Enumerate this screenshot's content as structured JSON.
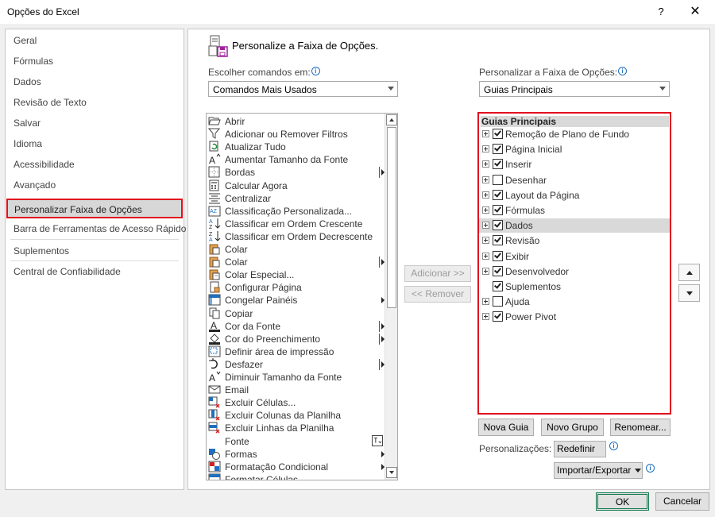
{
  "window": {
    "title": "Opções do Excel",
    "help": "?",
    "close": "✕"
  },
  "nav": {
    "items": [
      "Geral",
      "Fórmulas",
      "Dados",
      "Revisão de Texto",
      "Salvar",
      "Idioma",
      "Acessibilidade",
      "Avançado",
      "Personalizar Faixa de Opções",
      "Barra de Ferramentas de Acesso Rápido",
      "Suplementos",
      "Central de Confiabilidade"
    ],
    "selected": "Personalizar Faixa de Opções"
  },
  "main": {
    "heading": "Personalize a Faixa de Opções.",
    "choose_label": "Escolher comandos em:",
    "choose_value": "Comandos Mais Usados",
    "customize_label": "Personalizar a Faixa de Opções:",
    "customize_value": "Guias Principais"
  },
  "commands": [
    {
      "label": "Abrir",
      "icon": "folder-open-icon",
      "sub": false
    },
    {
      "label": "Adicionar ou Remover Filtros",
      "icon": "filter-icon",
      "sub": false
    },
    {
      "label": "Atualizar Tudo",
      "icon": "refresh-icon",
      "sub": false
    },
    {
      "label": "Aumentar Tamanho da Fonte",
      "icon": "font-grow-icon",
      "sub": false
    },
    {
      "label": "Bordas",
      "icon": "borders-icon",
      "sub": "bar"
    },
    {
      "label": "Calcular Agora",
      "icon": "calculator-icon",
      "sub": false
    },
    {
      "label": "Centralizar",
      "icon": "align-center-icon",
      "sub": false
    },
    {
      "label": "Classificação Personalizada...",
      "icon": "custom-sort-icon",
      "sub": false
    },
    {
      "label": "Classificar em Ordem Crescente",
      "icon": "sort-asc-icon",
      "sub": false
    },
    {
      "label": "Classificar em Ordem Decrescente",
      "icon": "sort-desc-icon",
      "sub": false
    },
    {
      "label": "Colar",
      "icon": "paste-icon",
      "sub": false
    },
    {
      "label": "Colar",
      "icon": "paste-icon",
      "sub": "bar"
    },
    {
      "label": "Colar Especial...",
      "icon": "paste-special-icon",
      "sub": false
    },
    {
      "label": "Configurar Página",
      "icon": "page-setup-icon",
      "sub": false
    },
    {
      "label": "Congelar Painéis",
      "icon": "freeze-panes-icon",
      "sub": "arrow"
    },
    {
      "label": "Copiar",
      "icon": "copy-icon",
      "sub": false
    },
    {
      "label": "Cor da Fonte",
      "icon": "font-color-icon",
      "sub": "bar"
    },
    {
      "label": "Cor do Preenchimento",
      "icon": "fill-color-icon",
      "sub": "bar"
    },
    {
      "label": "Definir área de impressão",
      "icon": "print-area-icon",
      "sub": false
    },
    {
      "label": "Desfazer",
      "icon": "undo-icon",
      "sub": "bar"
    },
    {
      "label": "Diminuir Tamanho da Fonte",
      "icon": "font-shrink-icon",
      "sub": false
    },
    {
      "label": "Email",
      "icon": "email-icon",
      "sub": false
    },
    {
      "label": "Excluir Células...",
      "icon": "delete-cells-icon",
      "sub": false
    },
    {
      "label": "Excluir Colunas da Planilha",
      "icon": "delete-columns-icon",
      "sub": false
    },
    {
      "label": "Excluir Linhas da Planilha",
      "icon": "delete-rows-icon",
      "sub": false
    },
    {
      "label": "Fonte",
      "icon": "",
      "sub": "fontbox"
    },
    {
      "label": "Formas",
      "icon": "shapes-icon",
      "sub": "arrow"
    },
    {
      "label": "Formatação Condicional",
      "icon": "conditional-format-icon",
      "sub": "arrow"
    },
    {
      "label": "Formatar Células",
      "icon": "format-cells-icon",
      "sub": false
    }
  ],
  "buttons": {
    "add": "Adicionar >>",
    "remove": "<< Remover",
    "new_tab": "Nova Guia",
    "new_group": "Novo Grupo",
    "rename": "Renomear...",
    "customizations_label": "Personalizações:",
    "reset": "Redefinir",
    "import_export": "Importar/Exportar",
    "ok": "OK",
    "cancel": "Cancelar"
  },
  "tree": {
    "header": "Guias Principais",
    "items": [
      {
        "label": "Remoção de Plano de Fundo",
        "checked": true,
        "expandable": true
      },
      {
        "label": "Página Inicial",
        "checked": true,
        "expandable": true
      },
      {
        "label": "Inserir",
        "checked": true,
        "expandable": true
      },
      {
        "label": "Desenhar",
        "checked": false,
        "expandable": true
      },
      {
        "label": "Layout da Página",
        "checked": true,
        "expandable": true
      },
      {
        "label": "Fórmulas",
        "checked": true,
        "expandable": true
      },
      {
        "label": "Dados",
        "checked": true,
        "expandable": true,
        "selected": true
      },
      {
        "label": "Revisão",
        "checked": true,
        "expandable": true
      },
      {
        "label": "Exibir",
        "checked": true,
        "expandable": true
      },
      {
        "label": "Desenvolvedor",
        "checked": true,
        "expandable": true
      },
      {
        "label": "Suplementos",
        "checked": true,
        "expandable": false
      },
      {
        "label": "Ajuda",
        "checked": false,
        "expandable": true
      },
      {
        "label": "Power Pivot",
        "checked": true,
        "expandable": true
      }
    ]
  },
  "colors": {
    "highlight_border": "#e0101e",
    "ok_border": "#0f7a4e",
    "info_blue": "#1f6fbf"
  }
}
